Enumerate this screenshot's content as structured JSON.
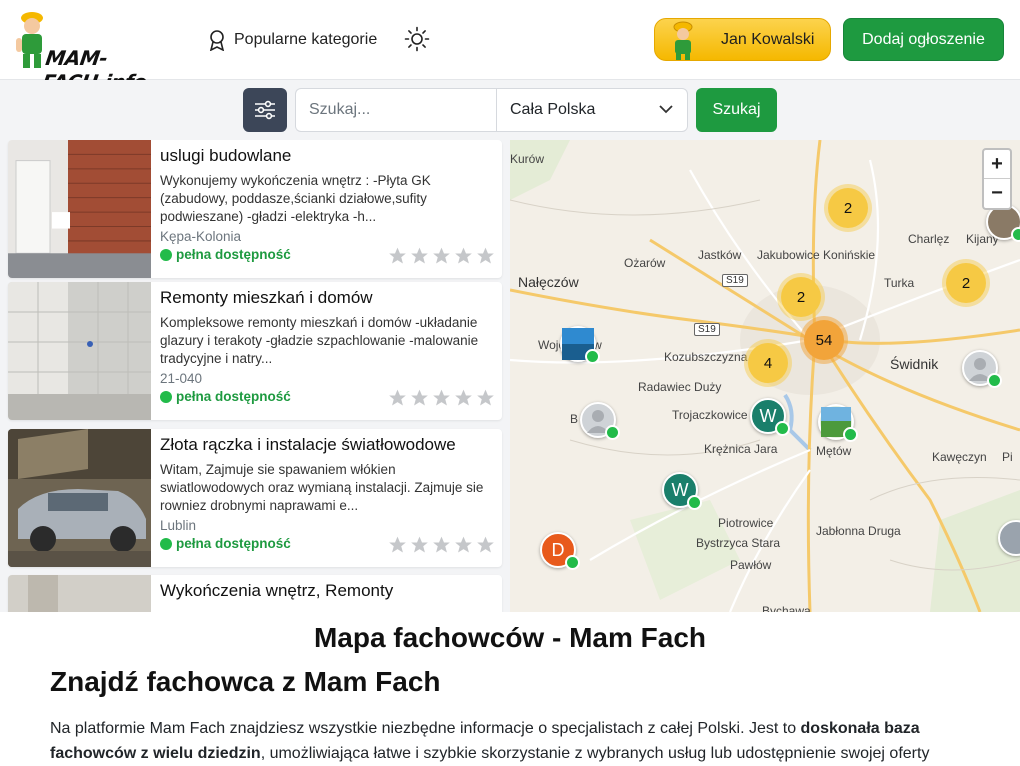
{
  "header": {
    "logo_text": "MAM-FACH.info",
    "popular_categories": "Popularne kategorie",
    "user_name": "Jan Kowalski",
    "add_listing": "Dodaj ogłoszenie"
  },
  "search": {
    "placeholder": "Szukaj...",
    "region": "Cała Polska",
    "button": "Szukaj"
  },
  "listings": [
    {
      "title": "uslugi budowlane",
      "description": "Wykonujemy wykończenia wnętrz : -Płyta GK (zabudowy, poddasze,ścianki działowe,sufity podwieszane) -gładzi -elektryka -h...",
      "location": "Kępa-Kolonia",
      "availability": "pełna dostępność"
    },
    {
      "title": "Remonty mieszkań i domów",
      "description": "Kompleksowe remonty mieszkań i domów -układanie glazury i terakoty -gładzie szpachlowanie -malowanie tradycyjne i natry...",
      "location": "21-040",
      "availability": "pełna dostępność"
    },
    {
      "title": "Złota rączka i instalacje światłowodowe",
      "description": "Witam, Zajmuje sie spawaniem włókien swiatlowodowych oraz wymianą instalacji. Zajmuje sie rowniez drobnymi naprawami e...",
      "location": "Lublin",
      "availability": "pełna dostępność"
    },
    {
      "title": "Wykończenia wnętrz, Remonty"
    }
  ],
  "map": {
    "zoom_in": "+",
    "zoom_out": "−",
    "towns": [
      "Kurów",
      "Jastków",
      "Jakubowice Konińskie",
      "Charlęz",
      "Kijany",
      "Ożarów",
      "Nałęczów",
      "Turka",
      "Wojciechów",
      "Kozubszczyzna",
      "Świdnik",
      "Radawiec Duży",
      "Trojaczkowice",
      "Krężnica Jara",
      "Mętów",
      "Kawęczyn",
      "Piotrowice",
      "Jabłonna Druga",
      "Bystrzyca Stara",
      "Pawłów",
      "Bychawa",
      "B",
      "Pi"
    ],
    "roads": [
      "S19",
      "S19"
    ],
    "clusters": [
      "2",
      "2",
      "2",
      "54",
      "4"
    ],
    "markers": [
      "W",
      "W",
      "D"
    ]
  },
  "content": {
    "h1": "Mapa fachowców - Mam Fach",
    "h2": "Znajdź fachowca z Mam Fach",
    "p_part1": "Na platformie Mam Fach znajdziesz wszystkie niezbędne informacje o specjalistach z całej Polski. Jest to ",
    "p_bold": "doskonała baza fachowców z wielu dziedzin",
    "p_part2": ", umożliwiająca łatwe i szybkie skorzystanie z wybranych usług lub udostępnienie swojej oferty"
  },
  "colors": {
    "accent_green": "#1e9a40",
    "accent_yellow": "#f6c944",
    "dark_button": "#3c4658"
  }
}
